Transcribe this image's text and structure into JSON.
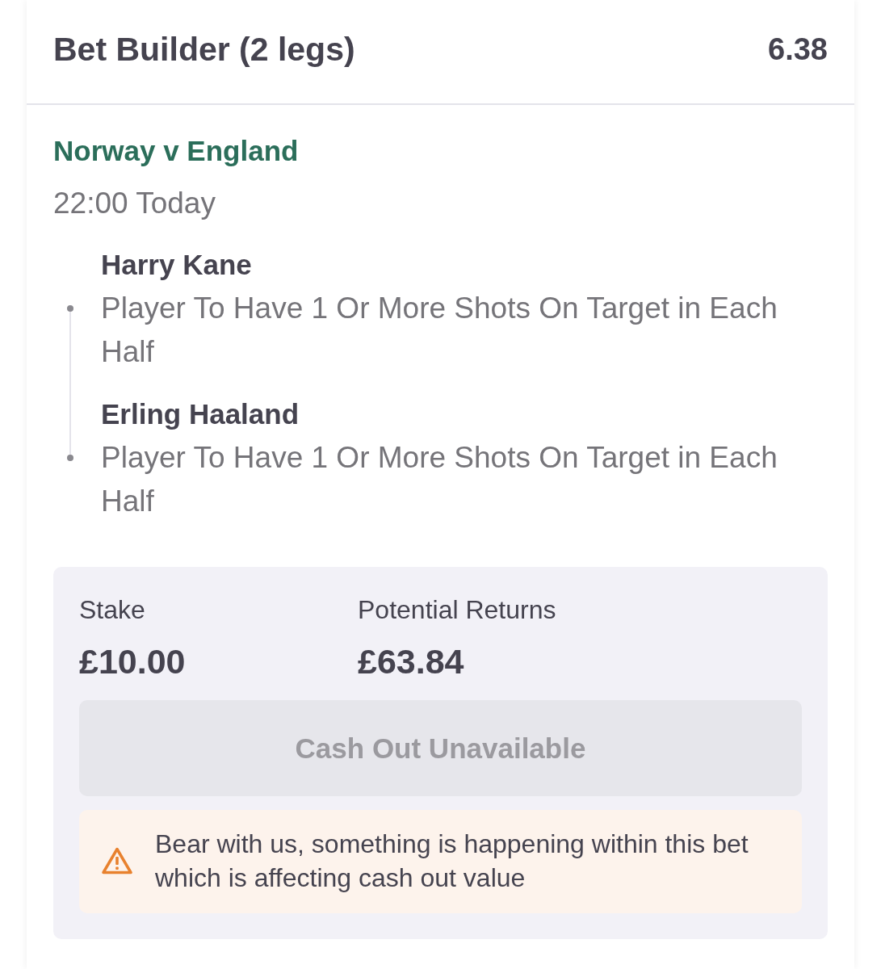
{
  "bet": {
    "title": "Bet Builder (2 legs)",
    "odds": "6.38"
  },
  "event": {
    "name": "Norway v England",
    "time": "22:00 Today"
  },
  "legs": [
    {
      "selection": "Harry Kane",
      "market": "Player To Have 1 Or More Shots On Target in Each Half"
    },
    {
      "selection": "Erling Haaland",
      "market": "Player To Have 1 Or More Shots On Target in Each Half"
    }
  ],
  "summary": {
    "stake_label": "Stake",
    "stake": "£10.00",
    "returns_label": "Potential Returns",
    "returns": "£63.84"
  },
  "cash_out": {
    "label": "Cash Out Unavailable",
    "disabled": true
  },
  "notice": {
    "kind": "warning",
    "text": "Bear with us, something is happening within this bet which is affecting cash out value"
  }
}
